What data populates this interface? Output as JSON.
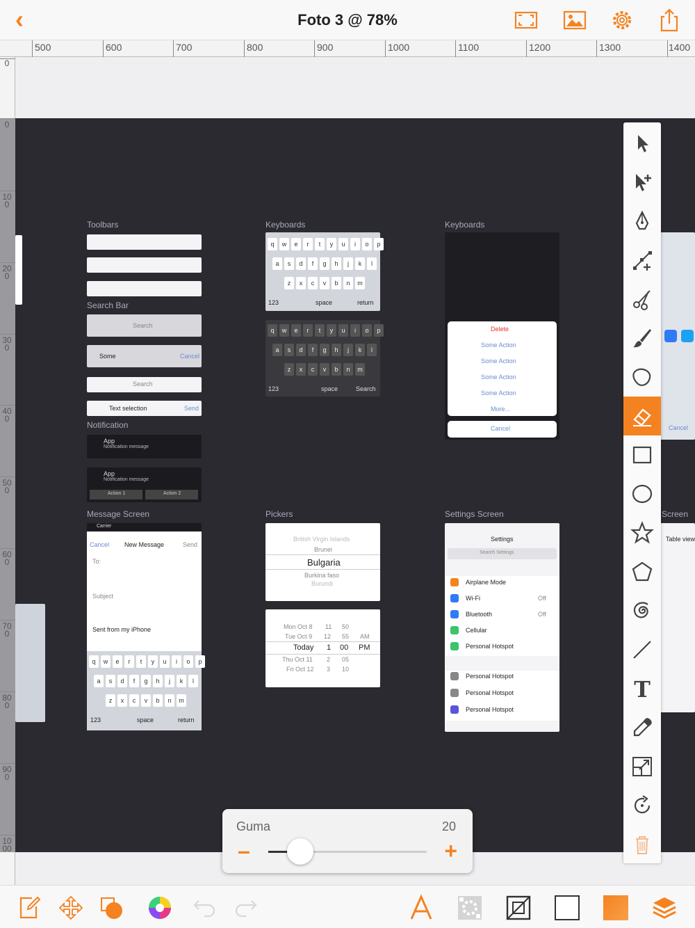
{
  "header": {
    "title": "Foto 3 @ 78%",
    "icons": [
      "back-chevron-icon",
      "fit-screen-icon",
      "image-icon",
      "gear-icon",
      "share-icon"
    ]
  },
  "ruler": {
    "horizontal_labels": [
      "500",
      "600",
      "700",
      "800",
      "900",
      "1000",
      "1100",
      "1200",
      "1300",
      "1400"
    ],
    "vertical_labels": [
      "0",
      "0",
      "100",
      "200",
      "300",
      "400",
      "500",
      "600",
      "700",
      "800",
      "900",
      "1000"
    ]
  },
  "canvas": {
    "sections": {
      "toolbars": "Toolbars",
      "search_bar": "Search Bar",
      "notification": "Notification",
      "message_screen": "Message Screen",
      "keyboards_1": "Keyboards",
      "keyboards_2": "Keyboards",
      "pickers": "Pickers",
      "settings_screen": "Settings Screen",
      "screen_partial": "Screen"
    },
    "keyboard_rows": [
      [
        "q",
        "w",
        "e",
        "r",
        "t",
        "y",
        "u",
        "i",
        "o",
        "p"
      ],
      [
        "a",
        "s",
        "d",
        "f",
        "g",
        "h",
        "j",
        "k",
        "l"
      ],
      [
        "z",
        "x",
        "c",
        "v",
        "b",
        "n",
        "m"
      ]
    ],
    "keyboard_bottom": {
      "num": "123",
      "space": "space",
      "return": "return",
      "search": "Search"
    },
    "action_sheet": {
      "items": [
        "Delete",
        "Some Action",
        "Some Action",
        "Some Action",
        "Some Action",
        "More..."
      ],
      "cancel": "Cancel"
    },
    "search_bar": {
      "search": "Search",
      "typed": "Some",
      "cancel": "Cancel",
      "text_selection": "Text selection",
      "send": "Send"
    },
    "notification": {
      "app": "App",
      "message": "Notification message",
      "action1": "Action 1",
      "action2": "Action 2"
    },
    "message_screen": {
      "cancel": "Cancel",
      "title": "New Message",
      "send": "Send",
      "to": "To:",
      "subject": "Subject",
      "body": "Sent from my iPhone",
      "carrier": "Carrier"
    },
    "picker": {
      "countries": [
        "British Virgin Islands",
        "Brunei",
        "Bulgaria",
        "Burkina faso",
        "Burundi"
      ],
      "dates": [
        {
          "d": "Mon Oct 8",
          "h": "11",
          "m": "50",
          "p": ""
        },
        {
          "d": "Tue Oct 9",
          "h": "12",
          "m": "55",
          "p": "AM"
        },
        {
          "d": "Today",
          "h": "1",
          "m": "00",
          "p": "PM"
        },
        {
          "d": "Thu Oct 11",
          "h": "2",
          "m": "05",
          "p": ""
        },
        {
          "d": "Fri Oct 12",
          "h": "3",
          "m": "10",
          "p": ""
        }
      ]
    },
    "settings": {
      "title": "Settings",
      "search": "Search Settings",
      "rows": [
        {
          "label": "Airplane Mode",
          "value": "",
          "color": "#f58220"
        },
        {
          "label": "Wi-Fi",
          "value": "Off",
          "color": "#2f7bf5"
        },
        {
          "label": "Bluetooth",
          "value": "Off",
          "color": "#2f7bf5"
        },
        {
          "label": "Cellular",
          "value": "",
          "color": "#3cc36b"
        },
        {
          "label": "Personal Hotspot",
          "value": "",
          "color": "#3cc36b"
        },
        {
          "label": "Personal Hotspot",
          "value": "",
          "color": "#888888"
        },
        {
          "label": "Personal Hotspot",
          "value": "",
          "color": "#888888"
        },
        {
          "label": "Personal Hotspot",
          "value": "",
          "color": "#5856d6"
        }
      ]
    },
    "partial_right": {
      "cancel": "Cancel",
      "table_view": "Table view"
    }
  },
  "palette": {
    "tools": [
      "arrow-select-icon",
      "add-select-icon",
      "pen-nib-icon",
      "bezier-icon",
      "scissors-icon",
      "brush-icon",
      "blob-shape-icon",
      "eraser-icon",
      "rectangle-icon",
      "ellipse-icon",
      "star-icon",
      "pentagon-icon",
      "spiral-icon",
      "line-icon",
      "text-tool-icon",
      "eyedropper-icon",
      "resize-icon",
      "rotate-icon",
      "trash-icon"
    ],
    "active": "eraser-icon"
  },
  "slider": {
    "name": "Guma",
    "value": 20,
    "min": 0,
    "max": 100
  },
  "bottom": {
    "icons": [
      "document-edit-icon",
      "transform-icon",
      "shapes-icon",
      "color-wheel-icon",
      "undo-icon",
      "redo-icon",
      "text-style-icon",
      "texture-icon",
      "frame-icon",
      "stroke-square-icon",
      "fill-square-icon",
      "layers-icon"
    ]
  },
  "colors": {
    "accent": "#f58220",
    "canvas": "#2a2a30",
    "link_blue": "#2f7bf5"
  }
}
